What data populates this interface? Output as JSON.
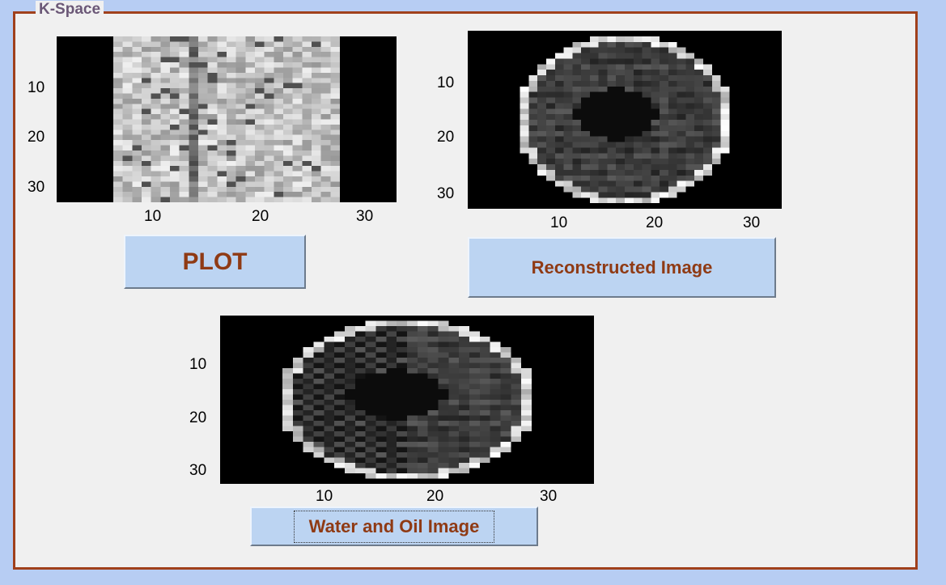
{
  "panel": {
    "title": "K-Space"
  },
  "axes_kspace": {
    "yticks": [
      "10",
      "20",
      "30"
    ],
    "xticks": [
      "10",
      "20",
      "30"
    ]
  },
  "axes_recon": {
    "yticks": [
      "10",
      "20",
      "30"
    ],
    "xticks": [
      "10",
      "20",
      "30"
    ]
  },
  "axes_water": {
    "yticks": [
      "10",
      "20",
      "30"
    ],
    "xticks": [
      "10",
      "20",
      "30"
    ]
  },
  "buttons": {
    "plot": "PLOT",
    "reconstructed": "Reconstructed Image",
    "water_oil": "Water and Oil Image"
  },
  "colors": {
    "background": "#b7cdf3",
    "panel_border": "#a0401c",
    "button_face": "#bcd4f2",
    "button_text": "#8f3a14",
    "title_text": "#6b5877"
  }
}
